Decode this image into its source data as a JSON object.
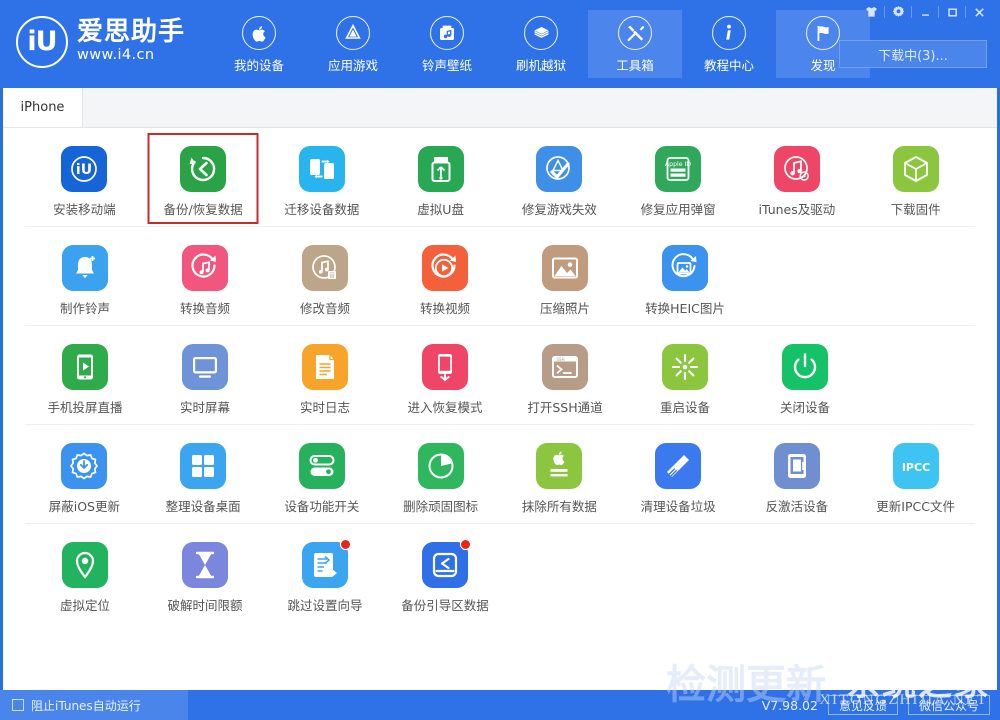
{
  "app": {
    "logo_text": "爱思助手",
    "logo_url": "www.i4.cn",
    "logo_mark": "iU",
    "version": "V7.98.02"
  },
  "header": {
    "nav": [
      {
        "label": "我的设备",
        "icon": "apple-icon",
        "active": false
      },
      {
        "label": "应用游戏",
        "icon": "appstore-icon",
        "active": false
      },
      {
        "label": "铃声壁纸",
        "icon": "ringtone-wallpaper-icon",
        "active": false
      },
      {
        "label": "刷机越狱",
        "icon": "flash-jailbreak-icon",
        "active": false
      },
      {
        "label": "工具箱",
        "icon": "toolbox-icon",
        "active": true
      },
      {
        "label": "教程中心",
        "icon": "info-icon",
        "active": false
      },
      {
        "label": "发现",
        "icon": "flag-icon",
        "active": true
      }
    ],
    "window_controls": [
      {
        "name": "skin-icon",
        "glyph": "skin"
      },
      {
        "name": "settings-gear-icon",
        "glyph": "gear"
      },
      {
        "name": "minimize-icon",
        "glyph": "minimize"
      },
      {
        "name": "maximize-icon",
        "glyph": "maximize"
      },
      {
        "name": "close-icon",
        "glyph": "close"
      }
    ],
    "download_button": "下载中(3)..."
  },
  "tabs": [
    {
      "label": "iPhone",
      "active": true
    }
  ],
  "toolbox": {
    "selected_tool": "备份/恢复数据",
    "rows": [
      [
        {
          "label": "安装移动端",
          "icon": "i4-mobile-icon",
          "color": "#1565d8",
          "badge": false
        },
        {
          "label": "备份/恢复数据",
          "icon": "backup-restore-icon",
          "color": "#2aa346",
          "badge": false,
          "selected": true
        },
        {
          "label": "迁移设备数据",
          "icon": "migrate-data-icon",
          "color": "#28b4ef",
          "badge": false
        },
        {
          "label": "虚拟U盘",
          "icon": "usb-drive-icon",
          "color": "#28a852",
          "badge": false
        },
        {
          "label": "修复游戏失效",
          "icon": "fix-game-icon",
          "color": "#3d8fe8",
          "badge": false
        },
        {
          "label": "修复应用弹窗",
          "icon": "fix-appleid-popup-icon",
          "color": "#2fa85b",
          "badge": false
        },
        {
          "label": "iTunes及驱动",
          "icon": "itunes-driver-icon",
          "color": "#ef4668",
          "badge": false
        },
        {
          "label": "下载固件",
          "icon": "firmware-box-icon",
          "color": "#8cc63f",
          "badge": false
        }
      ],
      [
        {
          "label": "制作铃声",
          "icon": "make-ringtone-icon",
          "color": "#3ba2ef",
          "badge": false
        },
        {
          "label": "转换音频",
          "icon": "convert-audio-icon",
          "color": "#f2557d",
          "badge": false
        },
        {
          "label": "修改音频",
          "icon": "edit-audio-icon",
          "color": "#bda589",
          "badge": false
        },
        {
          "label": "转换视频",
          "icon": "convert-video-icon",
          "color": "#f4603c",
          "badge": false
        },
        {
          "label": "压缩照片",
          "icon": "compress-photo-icon",
          "color": "#c09b7d",
          "badge": false
        },
        {
          "label": "转换HEIC图片",
          "icon": "convert-heic-icon",
          "color": "#3b93ef",
          "badge": false
        }
      ],
      [
        {
          "label": "手机投屏直播",
          "icon": "screen-cast-icon",
          "color": "#2fab4c",
          "badge": false
        },
        {
          "label": "实时屏幕",
          "icon": "realtime-screen-icon",
          "color": "#6f93d8",
          "badge": false
        },
        {
          "label": "实时日志",
          "icon": "realtime-log-icon",
          "color": "#f6a42a",
          "badge": false
        },
        {
          "label": "进入恢复模式",
          "icon": "recovery-mode-icon",
          "color": "#ef4668",
          "badge": false
        },
        {
          "label": "打开SSH通道",
          "icon": "ssh-terminal-icon",
          "color": "#b79c88",
          "badge": false
        },
        {
          "label": "重启设备",
          "icon": "reboot-device-icon",
          "color": "#8cc63f",
          "badge": false
        },
        {
          "label": "关闭设备",
          "icon": "power-off-icon",
          "color": "#16c268",
          "badge": false
        }
      ],
      [
        {
          "label": "屏蔽iOS更新",
          "icon": "block-ios-update-icon",
          "color": "#3b93ef",
          "badge": false
        },
        {
          "label": "整理设备桌面",
          "icon": "arrange-desktop-icon",
          "color": "#3ba6ef",
          "badge": false
        },
        {
          "label": "设备功能开关",
          "icon": "feature-toggle-icon",
          "color": "#26b15c",
          "badge": false
        },
        {
          "label": "删除顽固图标",
          "icon": "delete-icon-stubborn",
          "color": "#2fb75d",
          "badge": false
        },
        {
          "label": "抹除所有数据",
          "icon": "erase-all-data-icon",
          "color": "#8cc63f",
          "badge": false
        },
        {
          "label": "清理设备垃圾",
          "icon": "clean-junk-icon",
          "color": "#3b79ef",
          "badge": false
        },
        {
          "label": "反激活设备",
          "icon": "deactivate-device-icon",
          "color": "#6f8fd0",
          "badge": false
        },
        {
          "label": "更新IPCC文件",
          "icon": "ipcc-file-icon",
          "color": "#3ec4f2",
          "badge": false,
          "text": "IPCC"
        }
      ],
      [
        {
          "label": "虚拟定位",
          "icon": "virtual-location-icon",
          "color": "#22b35e",
          "badge": false
        },
        {
          "label": "破解时间限额",
          "icon": "crack-time-limit-icon",
          "color": "#7b86dd",
          "badge": false
        },
        {
          "label": "跳过设置向导",
          "icon": "skip-setup-wizard-icon",
          "color": "#3ba6ef",
          "badge": true
        },
        {
          "label": "备份引导区数据",
          "icon": "backup-boot-data-icon",
          "color": "#2f6fe8",
          "badge": true
        }
      ]
    ]
  },
  "footer": {
    "block_itunes_label": "阻止iTunes自动运行",
    "block_itunes_checked": false,
    "version": "V7.98.02",
    "feedback_button": "意见反馈",
    "wechat_button": "微信公众号"
  },
  "watermark": {
    "main": "系统之家",
    "sub": "XITONGZHIJIA.NET",
    "ghost": "检测更新"
  }
}
